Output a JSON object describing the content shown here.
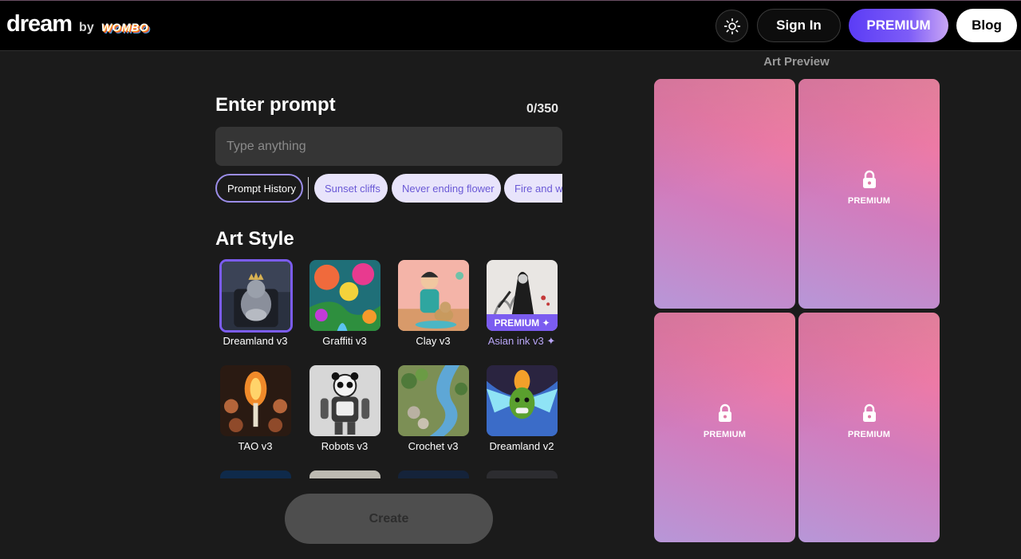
{
  "header": {
    "brand_name": "dream",
    "brand_by": "by",
    "brand_partner": "WOMBO",
    "signin_label": "Sign In",
    "premium_label": "PREMIUM",
    "blog_label": "Blog"
  },
  "prompt": {
    "title": "Enter prompt",
    "counter": "0/350",
    "placeholder": "Type anything",
    "value": ""
  },
  "chips": {
    "history_label": "Prompt History",
    "suggestions": [
      "Sunset cliffs",
      "Never ending flower",
      "Fire and water"
    ]
  },
  "art_style": {
    "title": "Art Style",
    "styles": [
      {
        "label": "Dreamland v3",
        "selected": true,
        "premium": false
      },
      {
        "label": "Graffiti v3",
        "selected": false,
        "premium": false
      },
      {
        "label": "Clay v3",
        "selected": false,
        "premium": false
      },
      {
        "label": "Asian ink v3 ✦",
        "selected": false,
        "premium": true,
        "badge": "PREMIUM ✦"
      },
      {
        "label": "TAO v3",
        "selected": false,
        "premium": false
      },
      {
        "label": "Robots v3",
        "selected": false,
        "premium": false
      },
      {
        "label": "Crochet v3",
        "selected": false,
        "premium": false
      },
      {
        "label": "Dreamland v2",
        "selected": false,
        "premium": false
      }
    ]
  },
  "create_label": "Create",
  "preview": {
    "title": "Art Preview",
    "cards": [
      {
        "locked": false,
        "label": ""
      },
      {
        "locked": true,
        "label": "PREMIUM"
      },
      {
        "locked": true,
        "label": "PREMIUM"
      },
      {
        "locked": true,
        "label": "PREMIUM"
      }
    ]
  },
  "colors": {
    "accent": "#7b5cf0",
    "background": "#1b1b1b",
    "header": "#000000",
    "chip_bg": "#e8e4fb",
    "chip_text": "#6a59d6"
  }
}
